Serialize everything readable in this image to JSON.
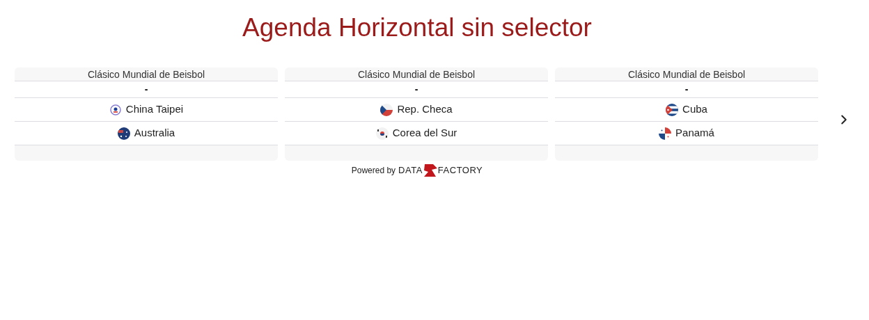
{
  "title": "Agenda Horizontal sin selector",
  "matches": [
    {
      "competition": "Clásico Mundial de Beisbol",
      "score": "-",
      "teams": [
        {
          "name": "China Taipei",
          "kind": "tpe"
        },
        {
          "name": "Australia",
          "kind": "aus"
        }
      ]
    },
    {
      "competition": "Clásico Mundial de Beisbol",
      "score": "-",
      "teams": [
        {
          "name": "Rep. Checa",
          "kind": "cze"
        },
        {
          "name": "Corea del Sur",
          "kind": "kor"
        }
      ]
    },
    {
      "competition": "Clásico Mundial de Beisbol",
      "score": "-",
      "teams": [
        {
          "name": "Cuba",
          "kind": "cub"
        },
        {
          "name": "Panamá",
          "kind": "pan"
        }
      ]
    }
  ],
  "footer": {
    "powered_by": "Powered by",
    "logo_left": "DATA",
    "logo_right": "FACTORY"
  }
}
